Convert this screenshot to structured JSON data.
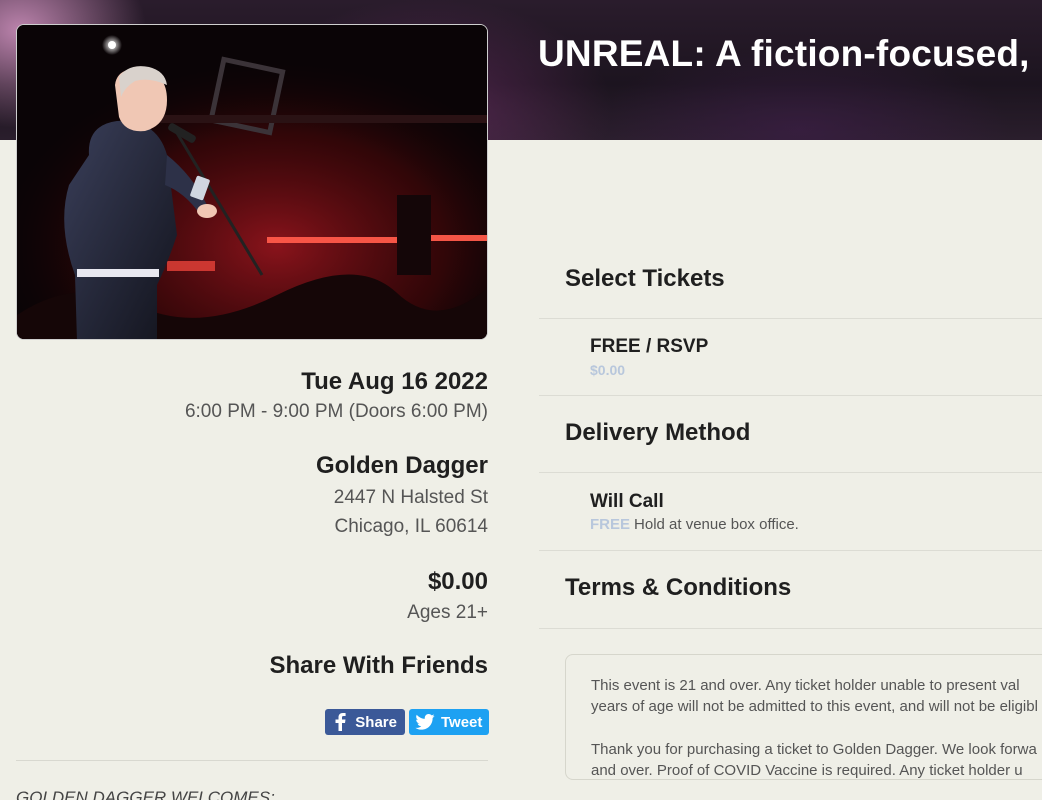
{
  "header": {
    "title": "UNREAL: A fiction-focused,"
  },
  "event": {
    "date": "Tue Aug 16 2022",
    "time": "6:00 PM - 9:00 PM (Doors 6:00 PM)",
    "venue_name": "Golden Dagger",
    "venue_street": "2447 N Halsted St",
    "venue_city": "Chicago, IL 60614",
    "price": "$0.00",
    "ages": "Ages 21+"
  },
  "share": {
    "heading": "Share With Friends",
    "facebook_label": "Share",
    "twitter_label": "Tweet"
  },
  "description": {
    "intro": "GOLDEN DAGGER WELCOMES:"
  },
  "tickets": {
    "heading": "Select Tickets",
    "options": [
      {
        "name": "FREE / RSVP",
        "price": "$0.00"
      }
    ]
  },
  "delivery": {
    "heading": "Delivery Method",
    "options": [
      {
        "name": "Will Call",
        "price_tag": "FREE",
        "note": "Hold at venue box office."
      }
    ]
  },
  "terms": {
    "heading": "Terms & Conditions",
    "line1": "This event is 21 and over. Any ticket holder unable to present val",
    "line2": "years of age will not be admitted to this event, and will not be eligibl",
    "line3": "Thank you for purchasing a ticket to Golden Dagger. We look forwa",
    "line4": "and over. Proof of COVID Vaccine is required. Any ticket holder u"
  },
  "colors": {
    "facebook": "#3b5998",
    "twitter": "#1da1f2",
    "free_tag": "#b8c7dc",
    "page_background": "#efefe7"
  }
}
